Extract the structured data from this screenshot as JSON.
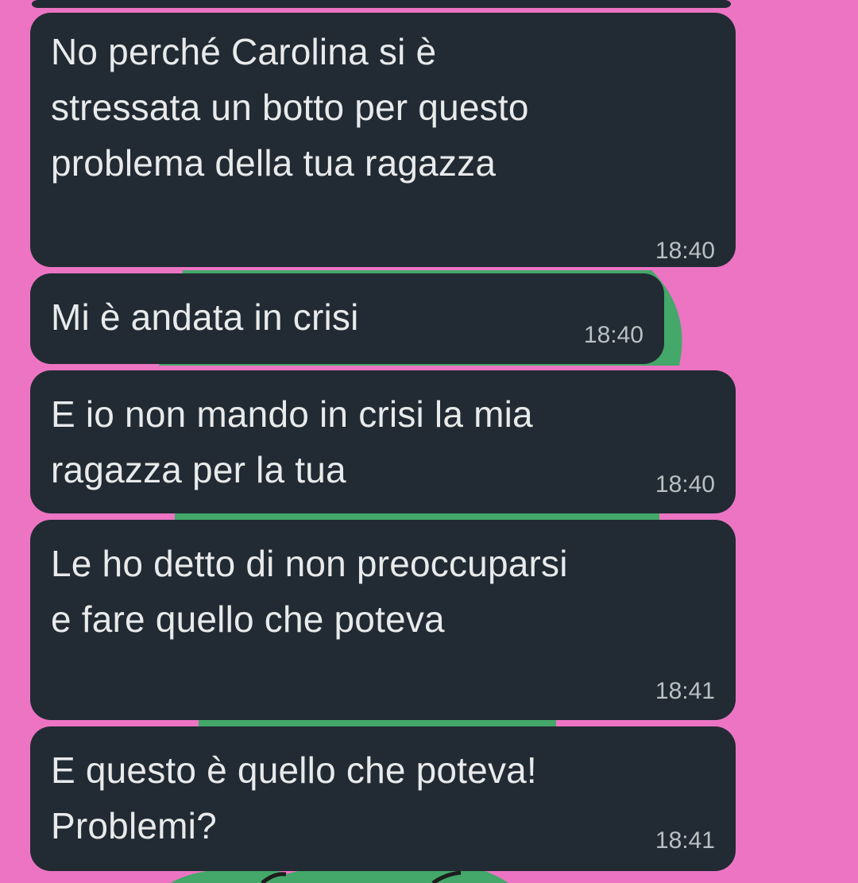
{
  "theme": {
    "background_color": "#ec74c3",
    "bubble_color": "#222b33",
    "text_color": "#e8eaeb",
    "time_color": "#b9c0c4",
    "sticker_color": "#43a869"
  },
  "messages": [
    {
      "text": "No perché Carolina si è\nstressata un botto per questo\nproblema della tua ragazza",
      "time": "18:40"
    },
    {
      "text": "Mi è andata in crisi",
      "time": "18:40"
    },
    {
      "text": "E io non mando in crisi la mia\nragazza per la tua",
      "time": "18:40"
    },
    {
      "text": "Le ho detto di non preoccuparsi\ne fare quello che poteva",
      "time": "18:41"
    },
    {
      "text": "E questo è quello che poteva!\nProblemi?",
      "time": "18:41"
    }
  ]
}
